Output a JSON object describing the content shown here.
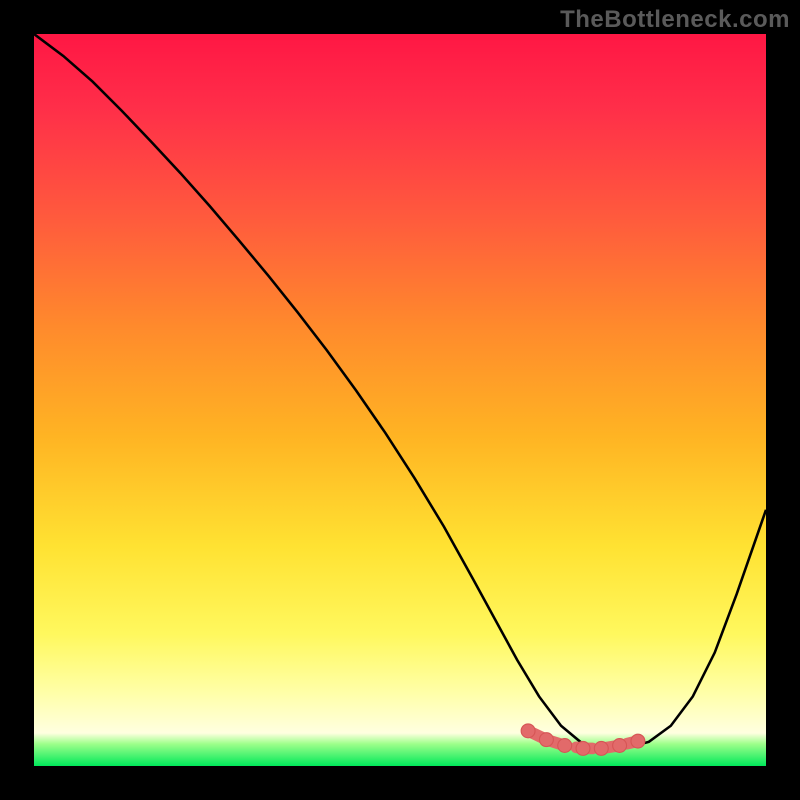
{
  "watermark": "TheBottleneck.com",
  "colors": {
    "frame": "#000000",
    "watermark": "#5a5a5a",
    "curve": "#000000",
    "marker_fill": "#e26a6a",
    "marker_stroke": "#d65555",
    "gradient_stops": [
      {
        "offset": 0.0,
        "color": "#ff1744"
      },
      {
        "offset": 0.1,
        "color": "#ff2e49"
      },
      {
        "offset": 0.25,
        "color": "#ff5a3d"
      },
      {
        "offset": 0.4,
        "color": "#ff8a2c"
      },
      {
        "offset": 0.55,
        "color": "#ffb423"
      },
      {
        "offset": 0.7,
        "color": "#ffe232"
      },
      {
        "offset": 0.82,
        "color": "#fff85e"
      },
      {
        "offset": 0.9,
        "color": "#ffffa8"
      },
      {
        "offset": 0.955,
        "color": "#ffffe0"
      },
      {
        "offset": 0.97,
        "color": "#9cff8a"
      },
      {
        "offset": 1.0,
        "color": "#00e85a"
      }
    ]
  },
  "chart_data": {
    "type": "line",
    "title": "",
    "xlabel": "",
    "ylabel": "",
    "xlim": [
      0,
      100
    ],
    "ylim": [
      0,
      100
    ],
    "series": [
      {
        "name": "bottleneck-curve",
        "x": [
          0,
          4,
          8,
          12,
          16,
          20,
          24,
          28,
          32,
          36,
          40,
          44,
          48,
          52,
          56,
          60,
          63,
          66,
          69,
          72,
          75,
          78,
          81,
          84,
          87,
          90,
          93,
          96,
          100
        ],
        "y": [
          100,
          97,
          93.5,
          89.5,
          85.3,
          81,
          76.5,
          71.8,
          67,
          62,
          56.8,
          51.3,
          45.5,
          39.3,
          32.7,
          25.5,
          20,
          14.5,
          9.5,
          5.5,
          3.0,
          2.2,
          2.5,
          3.3,
          5.5,
          9.5,
          15.5,
          23.5,
          35
        ]
      }
    ],
    "markers": {
      "name": "optimal-range",
      "x": [
        67.5,
        70,
        72.5,
        75,
        77.5,
        80,
        82.5
      ],
      "y": [
        4.8,
        3.6,
        2.8,
        2.4,
        2.4,
        2.8,
        3.4
      ]
    }
  }
}
